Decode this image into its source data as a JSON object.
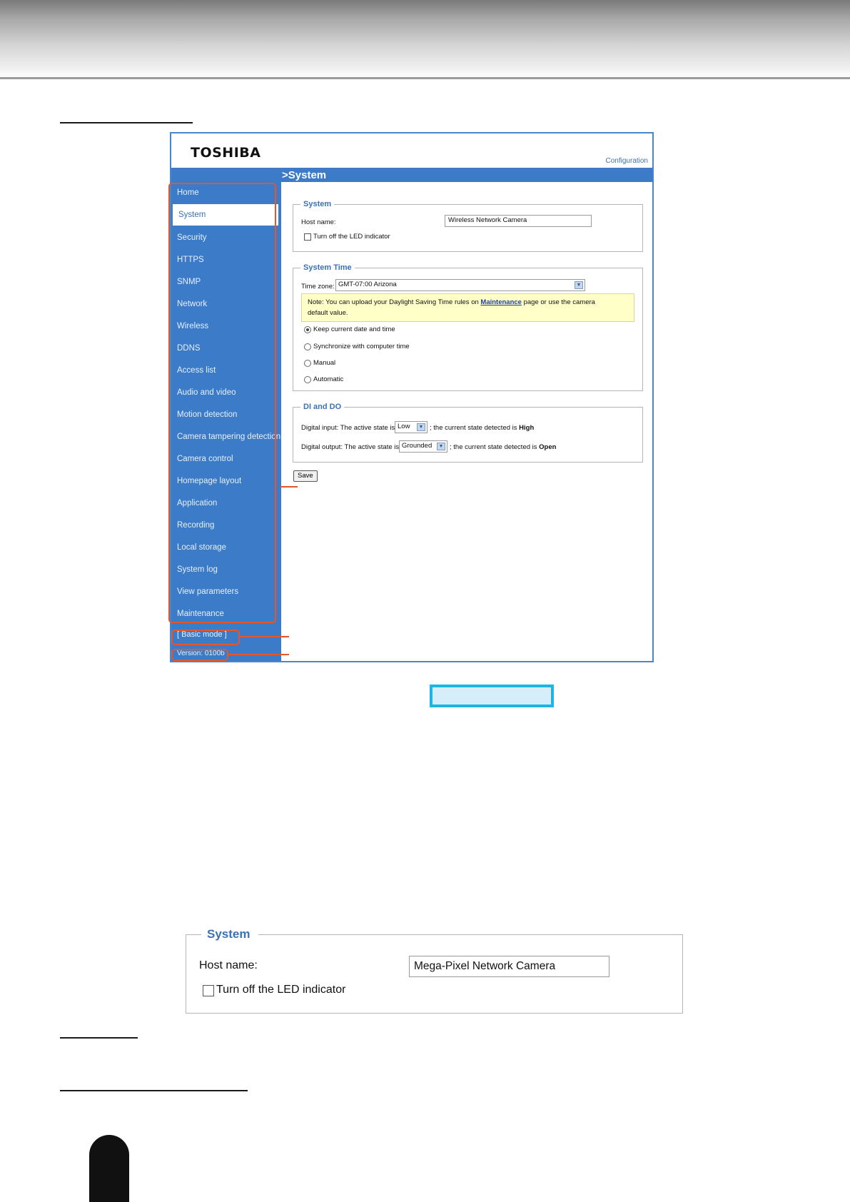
{
  "app": {
    "logo": "TOSHIBA",
    "config_link": "Configuration",
    "page_title": ">System"
  },
  "sidebar": {
    "items": [
      {
        "label": "Home",
        "active": false
      },
      {
        "label": "System",
        "active": true
      },
      {
        "label": "Security",
        "active": false
      },
      {
        "label": "HTTPS",
        "active": false
      },
      {
        "label": "SNMP",
        "active": false
      },
      {
        "label": "Network",
        "active": false
      },
      {
        "label": "Wireless",
        "active": false
      },
      {
        "label": "DDNS",
        "active": false
      },
      {
        "label": "Access list",
        "active": false
      },
      {
        "label": "Audio and video",
        "active": false
      },
      {
        "label": "Motion detection",
        "active": false
      },
      {
        "label": "Camera tampering detection",
        "active": false
      },
      {
        "label": "Camera control",
        "active": false
      },
      {
        "label": "Homepage layout",
        "active": false
      },
      {
        "label": "Application",
        "active": false
      },
      {
        "label": "Recording",
        "active": false
      },
      {
        "label": "Local storage",
        "active": false
      },
      {
        "label": "System log",
        "active": false
      },
      {
        "label": "View parameters",
        "active": false
      },
      {
        "label": "Maintenance",
        "active": false
      }
    ],
    "basic_mode": "[ Basic mode ]",
    "version": "Version: 0100b"
  },
  "system": {
    "legend": "System",
    "host_label": "Host name:",
    "host_value": "Wireless Network Camera",
    "led_label": "Turn off the LED indicator",
    "led_checked": false
  },
  "system_time": {
    "legend": "System Time",
    "tz_label": "Time zone:",
    "tz_value": "GMT-07:00 Arizona",
    "note_prefix": "Note: You can upload your Daylight Saving Time rules on",
    "note_link": "Maintenance",
    "note_suffix": "page or use the camera",
    "note_line2": "default value.",
    "options": [
      {
        "label": "Keep current date and time",
        "selected": true
      },
      {
        "label": "Synchronize with computer time",
        "selected": false
      },
      {
        "label": "Manual",
        "selected": false
      },
      {
        "label": "Automatic",
        "selected": false
      }
    ]
  },
  "dido": {
    "legend": "DI and DO",
    "di_prefix": "Digital input: The active state is",
    "di_value": "Low",
    "di_mid": "; the current state detected is",
    "di_state": "High",
    "do_prefix": "Digital output: The active state is",
    "do_value": "Grounded",
    "do_mid": "; the current state detected is",
    "do_state": "Open"
  },
  "save_label": "Save",
  "enlarged": {
    "legend": "System",
    "host_label": "Host name:",
    "host_value": "Mega-Pixel Network Camera",
    "led_label": "Turn off the LED indicator"
  },
  "colors": {
    "sidebar_bg": "#3b7bc8",
    "accent": "#3b72b5",
    "callout": "#e2572b",
    "highlight_box": "#1eb4e6"
  }
}
